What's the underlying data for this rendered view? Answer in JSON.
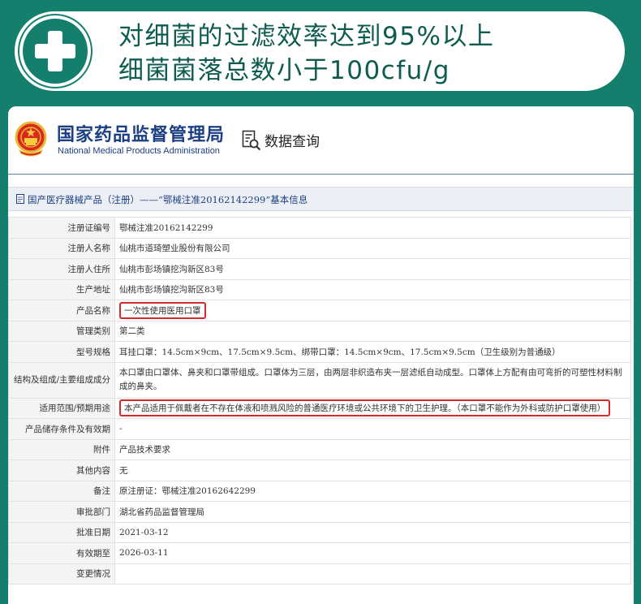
{
  "banner": {
    "line1": "对细菌的过滤效率达到95%以上",
    "line2": "细菌菌落总数小于100cfu/g",
    "icon": "medical-cross-icon",
    "bg_color": "#157f6e"
  },
  "site": {
    "org_cn": "国家药品监督管理局",
    "org_en": "National Medical Products Administration",
    "query_label": "数据查询",
    "brand_color": "#1c3e83"
  },
  "record": {
    "title": "国产医疗器械产品（注册）——“鄂械注准20162142299”基本信息",
    "rows": [
      {
        "label": "注册证编号",
        "value": "鄂械注准20162142299"
      },
      {
        "label": "注册人名称",
        "value": "仙桃市道琦塑业股份有限公司"
      },
      {
        "label": "注册人住所",
        "value": "仙桃市彭场镇挖沟新区83号"
      },
      {
        "label": "生产地址",
        "value": "仙桃市彭场镇挖沟新区83号"
      },
      {
        "label": "产品名称",
        "value": "一次性使用医用口罩",
        "highlight": true
      },
      {
        "label": "管理类别",
        "value": "第二类"
      },
      {
        "label": "型号规格",
        "value": "耳挂口罩：14.5cm×9cm、17.5cm×9.5cm、绑带口罩：14.5cm×9cm、17.5cm×9.5cm（卫生级别为普通级）"
      },
      {
        "label": "结构及组成/主要组成成分",
        "value": "本口罩由口罩体、鼻夹和口罩带组成。口罩体为三层，由两层非织造布夹一层滤纸自动成型。口罩体上方配有由可弯折的可塑性材料制成的鼻夹。"
      },
      {
        "label": "适用范围/预期用途",
        "value": "本产品适用于佩戴者在不存在体液和喷溅风险的普通医疗环境或公共环境下的卫生护理。（本口罩不能作为外科或防护口罩使用）",
        "highlight": true
      },
      {
        "label": "产品储存条件及有效期",
        "value": "-"
      },
      {
        "label": "附件",
        "value": "产品技术要求"
      },
      {
        "label": "其他内容",
        "value": "无"
      },
      {
        "label": "备注",
        "value": "原注册证：鄂械注准20162642299"
      },
      {
        "label": "审批部门",
        "value": "湖北省药品监督管理局"
      },
      {
        "label": "批准日期",
        "value": "2021-03-12"
      },
      {
        "label": "有效期至",
        "value": "2026-03-11"
      },
      {
        "label": "变更情况",
        "value": ""
      }
    ]
  },
  "highlight_color": "#d22b2b"
}
